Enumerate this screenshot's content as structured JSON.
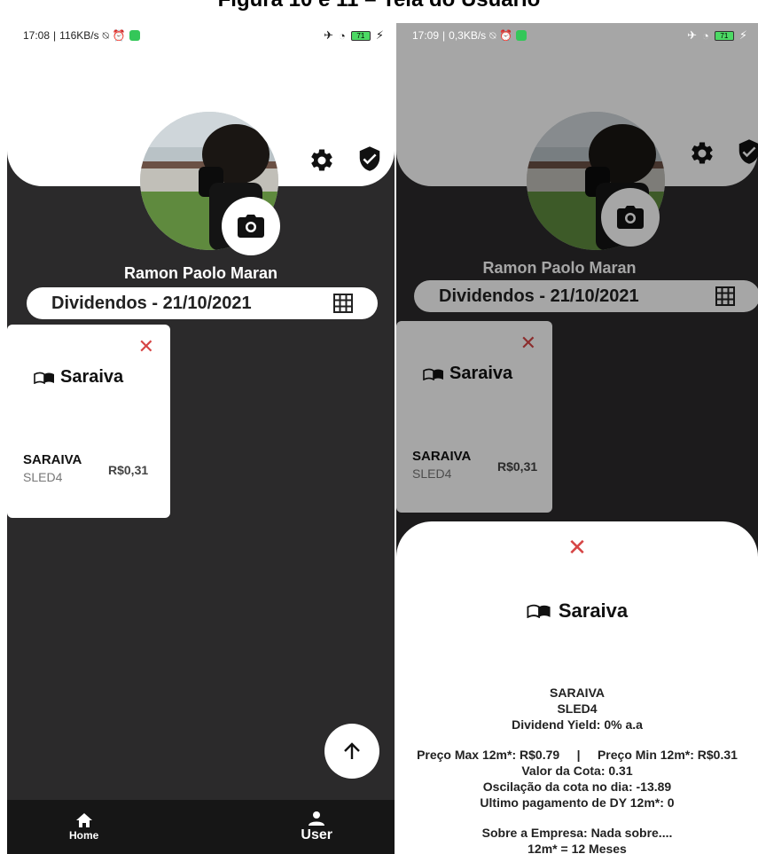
{
  "figure_title": "Figura 10 e 11 – Tela do Usuário",
  "left": {
    "status": {
      "time": "17:08",
      "net": "116KB/s",
      "battery": "71"
    },
    "username": "Ramon Paolo Maran",
    "date_label": "Dividendos - 21/10/2021",
    "card": {
      "close": "✕",
      "logo": "Saraiva",
      "name": "SARAIVA",
      "ticker": "SLED4",
      "price": "R$0,31"
    },
    "fab_icon": "arrow-up-icon",
    "nav": {
      "home": "Home",
      "user": "User"
    }
  },
  "right": {
    "status": {
      "time": "17:09",
      "net": "0,3KB/s",
      "battery": "71"
    },
    "username": "Ramon Paolo Maran",
    "date_label": "Dividendos - 21/10/2021",
    "card": {
      "close": "✕",
      "logo": "Saraiva",
      "name": "SARAIVA",
      "ticker": "SLED4",
      "price": "R$0,31"
    },
    "sheet": {
      "close": "✕",
      "logo": "Saraiva",
      "name": "SARAIVA",
      "ticker": "SLED4",
      "dy": "Dividend Yield: 0% a.a",
      "prices": "Preço Max 12m*: R$0.79     |     Preço Min 12m*: R$0.31",
      "valor": "Valor da Cota: 0.31",
      "osc": "Oscilação da cota no dia: -13.89",
      "ultimo": "Ultimo pagamento de DY 12m*: 0",
      "sobre": "Sobre a Empresa: Nada sobre....",
      "nota": "12m* = 12 Meses"
    }
  },
  "colors": {
    "background": "#2b2a2b",
    "close_red": "#d64545",
    "nav": "#161616"
  }
}
